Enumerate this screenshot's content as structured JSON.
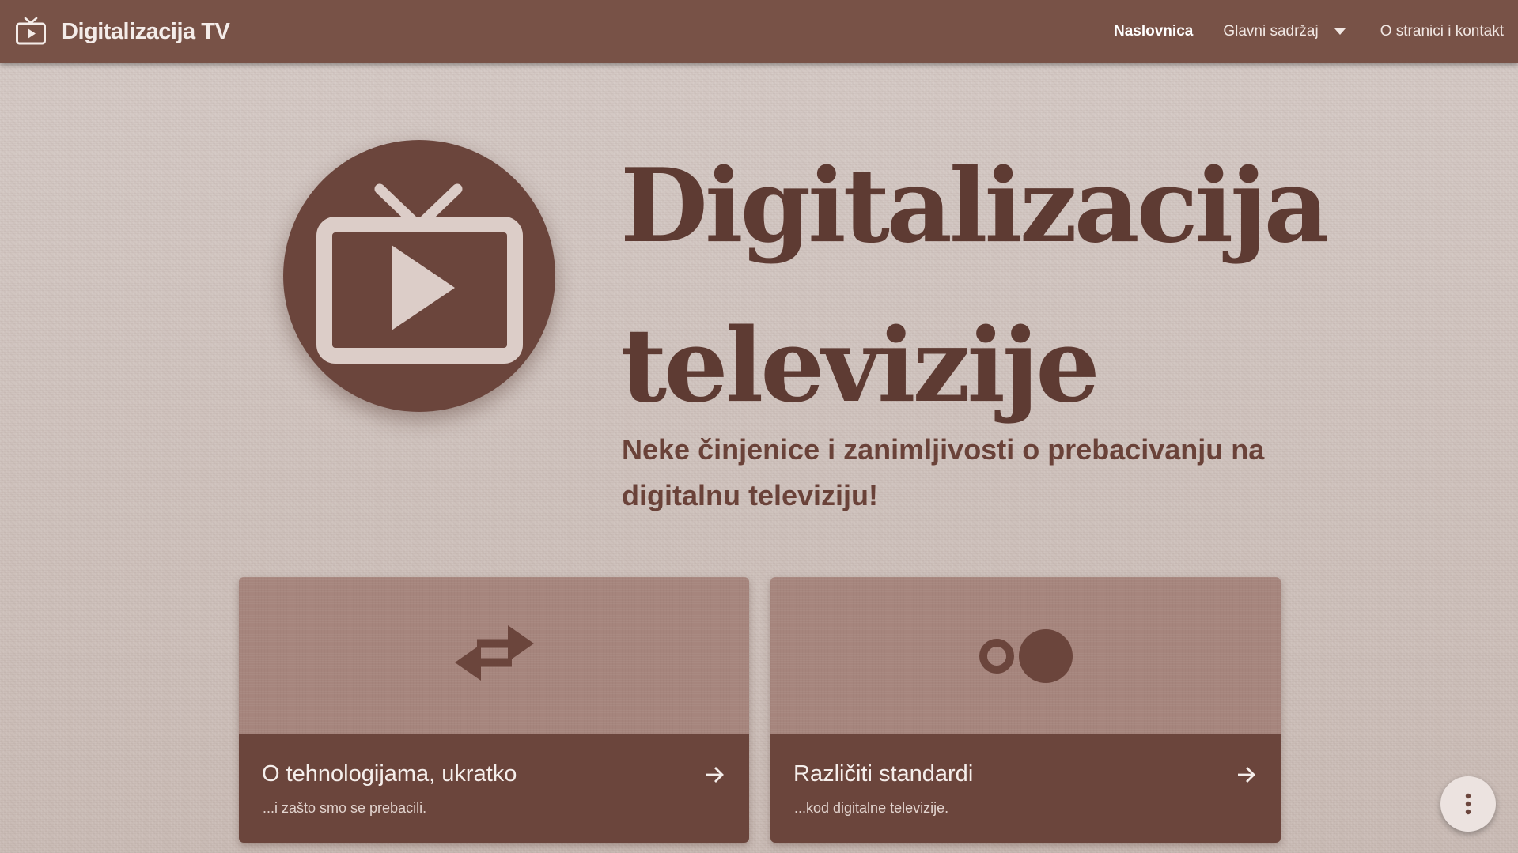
{
  "navbar": {
    "brand_title": "Digitalizacija TV",
    "brand_icon": "tv-play-icon",
    "links": {
      "home": "Naslovnica",
      "main_content": "Glavni sadržaj",
      "about": "O stranici i kontakt"
    },
    "active_link": "Naslovnica"
  },
  "hero": {
    "logo_icon": "tv-play-icon",
    "title_line1": "Digitalizacija",
    "title_line2": "televizije",
    "subtitle": "Neke činjenice i zanimljivosti o prebacivanju na digitalnu televiziju!"
  },
  "cards": [
    {
      "icon": "swap-arrows-icon",
      "title": "O tehnologijama, ukratko",
      "description": "...i zašto smo se prebacili."
    },
    {
      "icon": "toggle-circles-icon",
      "title": "Različiti standardi",
      "description": "...kod digitalne televizije."
    }
  ],
  "fab": {
    "icon": "more-vertical-icon"
  },
  "colors": {
    "navbar": "#785247",
    "primary_dark": "#6b453c",
    "title_text": "#5e3b33",
    "card_media": "#a6857d",
    "page_background": "#d2c6c2",
    "fab_background": "#ece3e0"
  }
}
